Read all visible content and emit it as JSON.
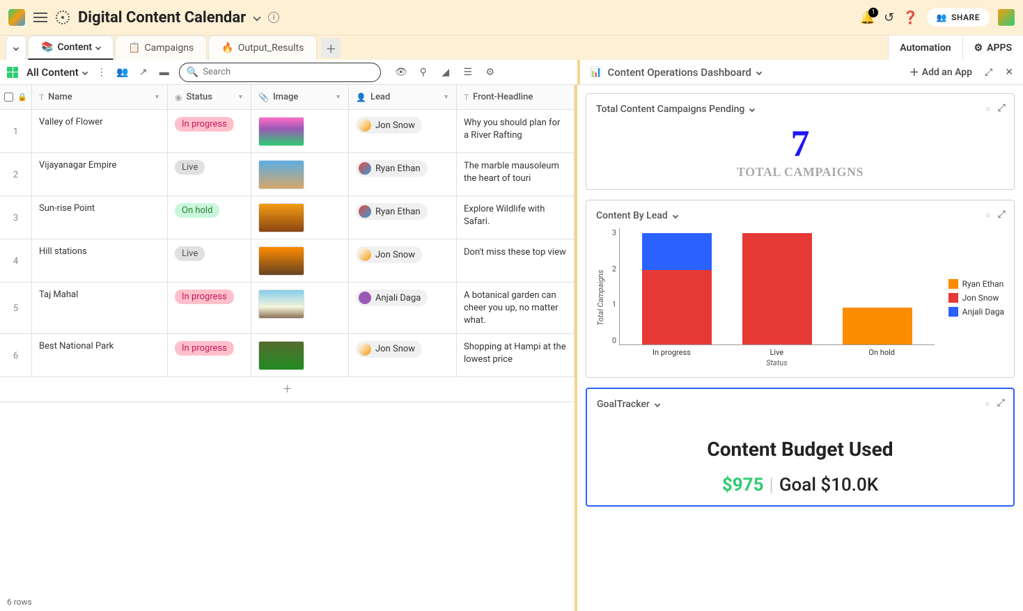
{
  "header": {
    "title": "Digital Content Calendar",
    "notification_count": "1",
    "share_label": "SHARE"
  },
  "tabs": {
    "items": [
      {
        "emoji": "📚",
        "label": "Content",
        "active": true
      },
      {
        "emoji": "📋",
        "label": "Campaigns",
        "active": false
      },
      {
        "emoji": "🔥",
        "label": "Output_Results",
        "active": false
      }
    ],
    "automation_label": "Automation",
    "apps_label": "APPS"
  },
  "toolbar": {
    "view_name": "All Content",
    "search_placeholder": "Search"
  },
  "columns": {
    "name": "Name",
    "status": "Status",
    "image": "Image",
    "lead": "Lead",
    "headline": "Front-Headline"
  },
  "rows": [
    {
      "num": "1",
      "name": "Valley of Flower",
      "status": "In progress",
      "status_class": "in-progress",
      "thumb": "flowers",
      "lead": "Jon Snow",
      "lead_avatar": "jon",
      "headline": "Why you should plan for a River Rafting "
    },
    {
      "num": "2",
      "name": "Vijayanagar Empire",
      "status": "Live",
      "status_class": "live",
      "thumb": "temple",
      "lead": "Ryan Ethan",
      "lead_avatar": "ryan",
      "headline": "The marble mausoleum the heart of touri"
    },
    {
      "num": "3",
      "name": "Sun-rise Point",
      "status": "On hold",
      "status_class": "on-hold",
      "thumb": "sunset",
      "lead": "Ryan Ethan",
      "lead_avatar": "ryan",
      "headline": "Explore Wildlife with Safari."
    },
    {
      "num": "4",
      "name": "Hill stations",
      "status": "Live",
      "status_class": "live",
      "thumb": "sunset2",
      "lead": "Jon Snow",
      "lead_avatar": "jon",
      "headline": "Don't miss these top view"
    },
    {
      "num": "5",
      "name": "Taj Mahal",
      "status": "In progress",
      "status_class": "in-progress",
      "thumb": "taj",
      "lead": "Anjali Daga",
      "lead_avatar": "anjali",
      "headline": "A botanical garden can cheer you up, no matter what."
    },
    {
      "num": "6",
      "name": "Best National Park",
      "status": "In progress",
      "status_class": "in-progress",
      "thumb": "forest",
      "lead": "Jon Snow",
      "lead_avatar": "jon",
      "headline": "Shopping at Hampi at the lowest price"
    }
  ],
  "footer": {
    "row_count": "6 rows"
  },
  "dashboard": {
    "title": "Content Operations Dashboard",
    "add_app_label": "Add an App",
    "card1": {
      "title": "Total Content Campaigns Pending",
      "value": "7",
      "label": "TOTAL CAMPAIGNS"
    },
    "card2": {
      "title": "Content By Lead"
    },
    "card3": {
      "title": "GoalTracker",
      "goal_title": "Content Budget Used",
      "current": "$975",
      "target": "Goal $10.0K"
    }
  },
  "chart_data": {
    "type": "bar",
    "stacked": true,
    "categories": [
      "In progress",
      "Live",
      "On hold"
    ],
    "series": [
      {
        "name": "Ryan Ethan",
        "color": "#fb8c00",
        "values": [
          0,
          0,
          1
        ]
      },
      {
        "name": "Jon Snow",
        "color": "#e53935",
        "values": [
          2,
          3,
          0
        ]
      },
      {
        "name": "Anjali Daga",
        "color": "#2962ff",
        "values": [
          1,
          0,
          0
        ]
      }
    ],
    "xlabel": "Status",
    "ylabel": "Total Campaigns",
    "y_ticks": [
      "0",
      "1",
      "2",
      "3"
    ],
    "ylim": [
      0,
      3
    ]
  }
}
